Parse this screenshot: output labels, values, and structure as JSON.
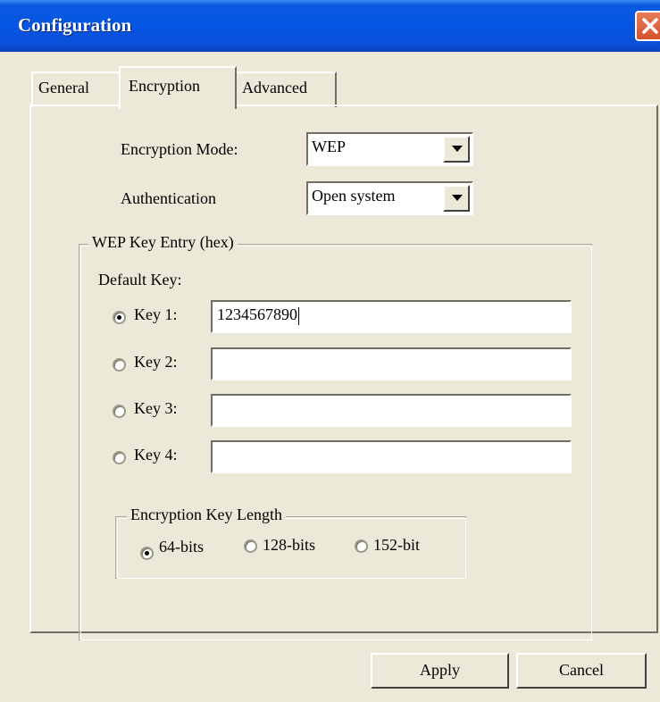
{
  "window": {
    "title": "Configuration"
  },
  "tabs": [
    {
      "label": "General",
      "selected": false
    },
    {
      "label": "Encryption",
      "selected": true
    },
    {
      "label": "Advanced",
      "selected": false
    }
  ],
  "encryption_mode": {
    "label": "Encryption Mode:",
    "value": "WEP"
  },
  "authentication": {
    "label": "Authentication",
    "value": "Open system"
  },
  "wep_group": {
    "legend": "WEP Key Entry (hex)",
    "default_key_label": "Default Key:",
    "keys": [
      {
        "label": "Key 1:",
        "value": "1234567890",
        "selected": true
      },
      {
        "label": "Key 2:",
        "value": "",
        "selected": false
      },
      {
        "label": "Key 3:",
        "value": "",
        "selected": false
      },
      {
        "label": "Key 4:",
        "value": "",
        "selected": false
      }
    ]
  },
  "key_length_group": {
    "legend": "Encryption Key Length",
    "options": [
      {
        "label": "64-bits",
        "selected": true
      },
      {
        "label": "128-bits",
        "selected": false
      },
      {
        "label": "152-bit",
        "selected": false
      }
    ]
  },
  "buttons": {
    "apply": "Apply",
    "cancel": "Cancel"
  }
}
